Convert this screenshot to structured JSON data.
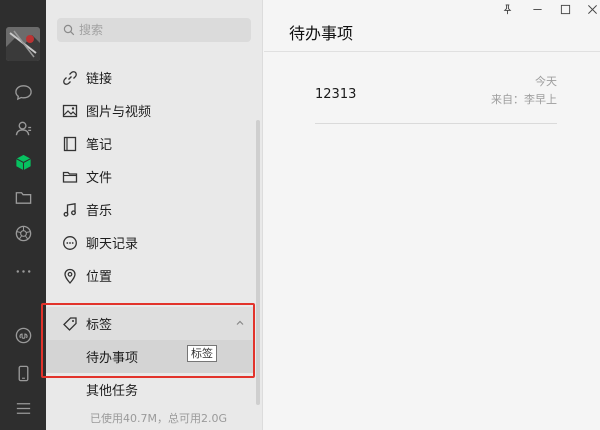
{
  "search": {
    "placeholder": "搜索"
  },
  "nav": {
    "items": [
      {
        "label": "链接",
        "icon": "link-icon"
      },
      {
        "label": "图片与视频",
        "icon": "image-icon"
      },
      {
        "label": "笔记",
        "icon": "note-icon"
      },
      {
        "label": "文件",
        "icon": "folder-icon"
      },
      {
        "label": "音乐",
        "icon": "music-icon"
      },
      {
        "label": "聊天记录",
        "icon": "chat-record-icon"
      },
      {
        "label": "位置",
        "icon": "location-icon"
      }
    ],
    "tags": {
      "label": "标签",
      "icon": "tag-icon",
      "children": [
        {
          "label": "待办事项",
          "active": true
        },
        {
          "label": "其他任务",
          "active": false
        }
      ]
    },
    "tooltip": "标签",
    "storage": "已使用40.7M，总可用2.0G"
  },
  "rail": {
    "icons": [
      "chat-icon",
      "contacts-icon",
      "favorites-icon",
      "files-icon",
      "moments-icon",
      "more-icon",
      "mini-programs-icon",
      "phone-icon",
      "menu-icon"
    ],
    "active": "favorites-icon",
    "accent": "#07c160"
  },
  "content": {
    "title": "待办事项",
    "notes": [
      {
        "title": "12313",
        "date": "今天",
        "source": "来自：李早上"
      }
    ]
  },
  "colors": {
    "highlight": "#e2332b"
  }
}
